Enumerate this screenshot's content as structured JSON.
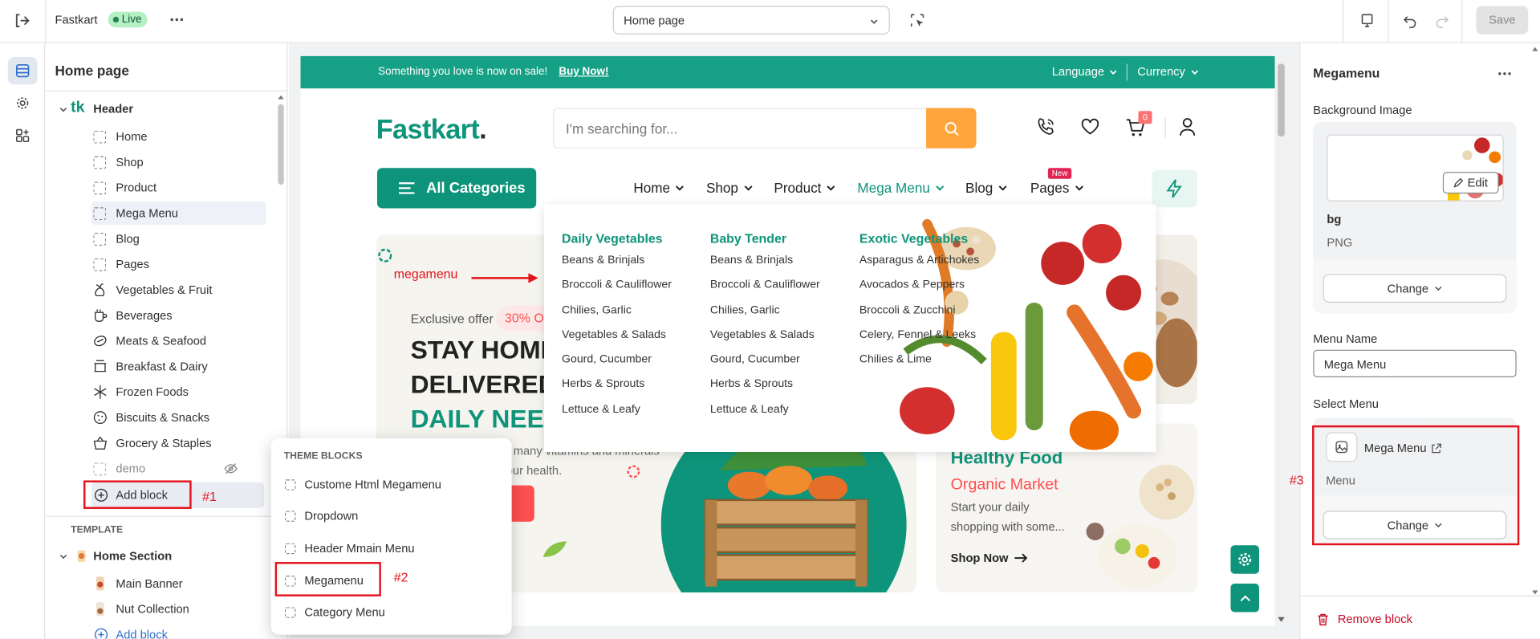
{
  "topbar": {
    "app_name": "Fastkart",
    "status": "Live",
    "page_selector": "Home page",
    "save_label": "Save"
  },
  "sidebar": {
    "title": "Home page",
    "header_section": "Header",
    "items": [
      {
        "label": "Home",
        "icon": "dashed-square-icon"
      },
      {
        "label": "Shop",
        "icon": "dashed-square-icon"
      },
      {
        "label": "Product",
        "icon": "dashed-square-icon"
      },
      {
        "label": "Mega Menu",
        "icon": "dashed-square-icon",
        "selected": true
      },
      {
        "label": "Blog",
        "icon": "dashed-square-icon"
      },
      {
        "label": "Pages",
        "icon": "dashed-square-icon"
      },
      {
        "label": "Vegetables & Fruit",
        "icon": "vegetables-icon"
      },
      {
        "label": "Beverages",
        "icon": "cup-icon"
      },
      {
        "label": "Meats & Seafood",
        "icon": "meat-icon"
      },
      {
        "label": "Breakfast & Dairy",
        "icon": "breakfast-icon"
      },
      {
        "label": "Frozen Foods",
        "icon": "snowflake-icon"
      },
      {
        "label": "Biscuits & Snacks",
        "icon": "biscuit-icon"
      },
      {
        "label": "Grocery & Staples",
        "icon": "basket-icon"
      },
      {
        "label": "demo",
        "icon": "dashed-square-icon",
        "hidden": true
      }
    ],
    "add_block": "Add block",
    "template_heading": "TEMPLATE",
    "home_section": "Home Section",
    "home_items": [
      "Main Banner",
      "Nut Collection"
    ],
    "add_block_2": "Add block"
  },
  "popup": {
    "heading": "THEME BLOCKS",
    "items": [
      "Custome Html Megamenu",
      "Dropdown",
      "Header Mmain Menu",
      "Megamenu",
      "Category Menu"
    ]
  },
  "preview": {
    "announcement": "Something you love is now on sale!",
    "announcement_link": "Buy Now!",
    "language": "Language",
    "currency": "Currency",
    "logo_main": "Fastkart",
    "logo_dot": ".",
    "search_placeholder": "I'm searching for...",
    "cart_count": "0",
    "all_categories": "All Categories",
    "nav": [
      "Home",
      "Shop",
      "Product",
      "Mega Menu",
      "Blog",
      "Pages"
    ],
    "nav_badge": "New",
    "banner": {
      "offer_label": "Exclusive offer",
      "offer_pct": "30% Off",
      "heading_1": "STAY HOME &",
      "heading_2": "DELIVERED YOUR",
      "heading_3": "DAILY NEEDS",
      "desc": "Vegetables contain many vitamins and minerals that are good for your health."
    },
    "side_banner": {
      "title": "Healthy Food",
      "subtitle": "Organic Market",
      "desc_1": "Start your daily",
      "desc_2": "shopping with some...",
      "cta": "Shop Now"
    },
    "megamenu": [
      {
        "title": "Daily Vegetables",
        "items": [
          "Beans & Brinjals",
          "Broccoli & Cauliflower",
          "Chilies, Garlic",
          "Vegetables & Salads",
          "Gourd, Cucumber",
          "Herbs & Sprouts",
          "Lettuce & Leafy"
        ]
      },
      {
        "title": "Baby Tender",
        "items": [
          "Beans & Brinjals",
          "Broccoli & Cauliflower",
          "Chilies, Garlic",
          "Vegetables & Salads",
          "Gourd, Cucumber",
          "Herbs & Sprouts",
          "Lettuce & Leafy"
        ]
      },
      {
        "title": "Exotic Vegetables",
        "items": [
          "Asparagus & Artichokes",
          "Avocados & Peppers",
          "Broccoli & Zucchini",
          "Celery, Fennel & Leeks",
          "Chilies & Lime"
        ]
      }
    ]
  },
  "rpanel": {
    "title": "Megamenu",
    "bg_label": "Background Image",
    "edit_label": "Edit",
    "file_name": "bg",
    "file_type": "PNG",
    "change_label": "Change",
    "menu_name_label": "Menu Name",
    "menu_name_value": "Mega Menu",
    "select_menu_label": "Select Menu",
    "selected_menu": "Mega Menu",
    "selected_menu_type": "Menu",
    "change_label_2": "Change",
    "remove_label": "Remove block"
  },
  "annotations": {
    "megamenu_note": "megamenu",
    "step1": "#1",
    "step2": "#2",
    "step3": "#3"
  },
  "colors": {
    "brand": "#0e947a",
    "announcement_bg": "#16a085",
    "accent_orange": "#ffa53b",
    "annotation_red": "#e3131b",
    "remove_red": "#c70a24"
  }
}
